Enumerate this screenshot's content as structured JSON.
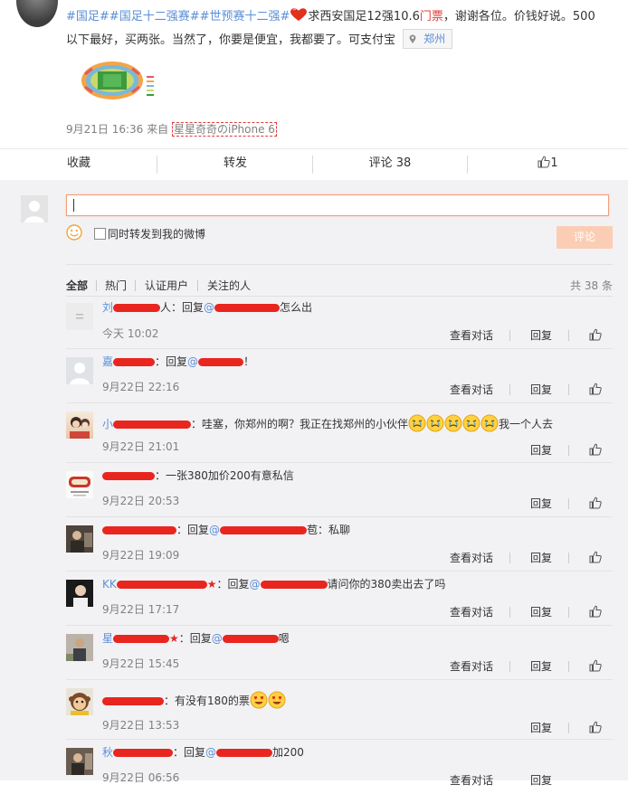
{
  "post": {
    "tag1": "#国足#",
    "tag2": "#国足十二强赛#",
    "tag3": "#世预赛十二强#",
    "text_a": "求西安国足12强10.6",
    "text_ticket": "门票",
    "text_b": "，谢谢各位。价钱好说。500",
    "line2": "以下最好，买两张。当然了，你要是便宜，我都要了。可支付宝",
    "location": "郑州",
    "time": "9月21日 16:36",
    "from_label": "来自",
    "source": "星星奇奇のiPhone 6"
  },
  "actions": {
    "collect": "收藏",
    "repost": "转发",
    "comment": "评论 38",
    "like_count": "1"
  },
  "composer": {
    "forward_label": "同时转发到我的微博",
    "submit": "评论"
  },
  "tabs": {
    "all": "全部",
    "hot": "热门",
    "verified": "认证用户",
    "following": "关注的人",
    "total": "共 38 条"
  },
  "labels": {
    "view_conversation": "查看对话",
    "reply": "回复"
  },
  "comments": [
    {
      "pre": "刘",
      "mid": "人：回复",
      "at": "@",
      "post": "怎么出",
      "time": "今天 10:02"
    },
    {
      "pre": "嘉",
      "mid": "：回复",
      "at": "@",
      "post": "！",
      "time": "9月22日 22:16"
    },
    {
      "pre": "小",
      "mid": "：哇塞，你郑州的啊？我正在找郑州的小伙伴",
      "post": "我一个人去",
      "time": "9月22日 21:01"
    },
    {
      "pre": "",
      "mid": "：一张380加价200有意私信",
      "post": "",
      "time": "9月22日 20:53"
    },
    {
      "pre": "",
      "mid": "：回复",
      "at": "@",
      "post": "苞：私聊",
      "time": "9月22日 19:09"
    },
    {
      "pre": "KK",
      "star": "★",
      "mid": "：回复",
      "at": "@",
      "post": "请问你的380卖出去了吗",
      "time": "9月22日 17:17"
    },
    {
      "pre": "星",
      "star": "★",
      "mid": "：回复",
      "at": "@",
      "post": "嗯",
      "time": "9月22日 15:45"
    },
    {
      "pre": "",
      "mid": "：有没有180的票",
      "post": "",
      "time": "9月22日 13:53"
    },
    {
      "pre": "秋",
      "mid": "：回复",
      "at": "@",
      "post": "加200",
      "time": "9月22日 06:56"
    }
  ],
  "colors": {
    "accent": "#eb7350",
    "link_blue": "#5b8fd6",
    "ticket_red": "#e03c3c",
    "redaction": "#e8261f",
    "submit_bg": "#fbcdb5",
    "panel_bg": "#f2f2f5"
  },
  "icons": {
    "heart": "heart-icon",
    "pin": "location-pin-icon",
    "smile": "smile-icon",
    "like": "thumbs-up-icon",
    "emoji_cry": "crying-face-icon",
    "emoji_love": "heart-eyes-face-icon"
  }
}
